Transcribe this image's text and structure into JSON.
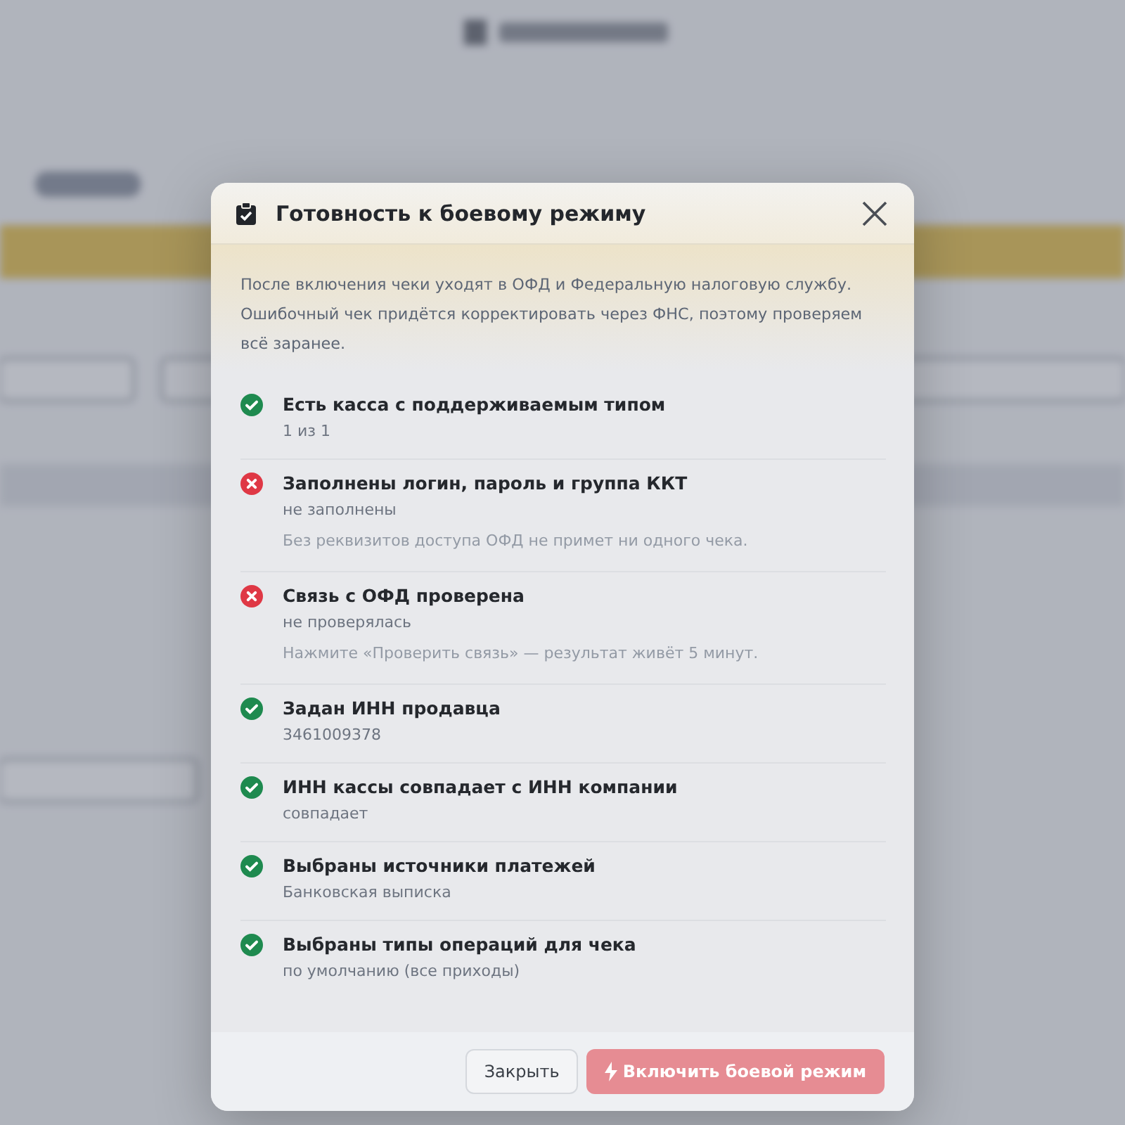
{
  "dialog": {
    "title": "Готовность к боевому режиму",
    "intro": "После включения чеки уходят в ОФД и Федеральную налоговую службу. Ошибочный чек придётся корректировать через ФНС, поэтому проверяем всё заранее.",
    "checks": [
      {
        "passed": true,
        "title": "Есть касса с поддерживаемым типом",
        "value": "1 из 1"
      },
      {
        "passed": false,
        "title": "Заполнены логин, пароль и группа ККТ",
        "value": "не заполнены",
        "hint": "Без реквизитов доступа ОФД не примет ни одного чека."
      },
      {
        "passed": false,
        "title": "Связь с ОФД проверена",
        "value": "не проверялась",
        "hint": "Нажмите «Проверить связь» — результат живёт 5 минут."
      },
      {
        "passed": true,
        "title": "Задан ИНН продавца",
        "value": "3461009378"
      },
      {
        "passed": true,
        "title": "ИНН кассы совпадает с ИНН компании",
        "value": "совпадает"
      },
      {
        "passed": true,
        "title": "Выбраны источники платежей",
        "value": "Банковская выписка"
      },
      {
        "passed": true,
        "title": "Выбраны типы операций для чека",
        "value": "по умолчанию (все приходы)"
      }
    ],
    "buttons": [
      {
        "label": "Закрыть",
        "kind": "secondary",
        "disabled": false
      },
      {
        "label": "Включить боевой режим",
        "kind": "primary",
        "disabled": true
      }
    ]
  }
}
